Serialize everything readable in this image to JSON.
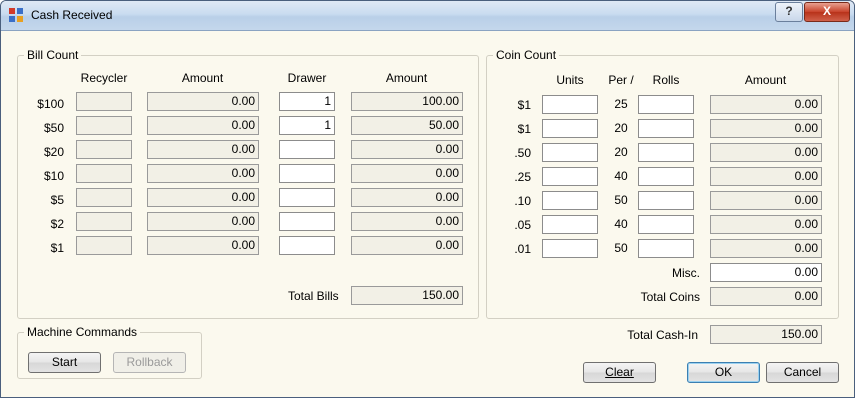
{
  "window": {
    "title": "Cash Received",
    "help_label": "?",
    "close_label": "X"
  },
  "bill_count": {
    "title": "Bill Count",
    "headers": {
      "recycler": "Recycler",
      "amount1": "Amount",
      "drawer": "Drawer",
      "amount2": "Amount"
    },
    "rows": [
      {
        "denom": "$100",
        "recycler": "",
        "amount1": "0.00",
        "drawer": "1",
        "amount2": "100.00"
      },
      {
        "denom": "$50",
        "recycler": "",
        "amount1": "0.00",
        "drawer": "1",
        "amount2": "50.00"
      },
      {
        "denom": "$20",
        "recycler": "",
        "amount1": "0.00",
        "drawer": "",
        "amount2": "0.00"
      },
      {
        "denom": "$10",
        "recycler": "",
        "amount1": "0.00",
        "drawer": "",
        "amount2": "0.00"
      },
      {
        "denom": "$5",
        "recycler": "",
        "amount1": "0.00",
        "drawer": "",
        "amount2": "0.00"
      },
      {
        "denom": "$2",
        "recycler": "",
        "amount1": "0.00",
        "drawer": "",
        "amount2": "0.00"
      },
      {
        "denom": "$1",
        "recycler": "",
        "amount1": "0.00",
        "drawer": "",
        "amount2": "0.00"
      }
    ],
    "total_label": "Total Bills",
    "total_value": "150.00"
  },
  "coin_count": {
    "title": "Coin Count",
    "headers": {
      "units": "Units",
      "per": "Per /",
      "rolls": "Rolls",
      "amount": "Amount"
    },
    "rows": [
      {
        "denom": "$1",
        "units": "",
        "per": "25",
        "rolls": "",
        "amount": "0.00"
      },
      {
        "denom": "$1",
        "units": "",
        "per": "20",
        "rolls": "",
        "amount": "0.00"
      },
      {
        "denom": ".50",
        "units": "",
        "per": "20",
        "rolls": "",
        "amount": "0.00"
      },
      {
        "denom": ".25",
        "units": "",
        "per": "40",
        "rolls": "",
        "amount": "0.00"
      },
      {
        "denom": ".10",
        "units": "",
        "per": "50",
        "rolls": "",
        "amount": "0.00"
      },
      {
        "denom": ".05",
        "units": "",
        "per": "40",
        "rolls": "",
        "amount": "0.00"
      },
      {
        "denom": ".01",
        "units": "",
        "per": "50",
        "rolls": "",
        "amount": "0.00"
      }
    ],
    "misc_label": "Misc.",
    "misc_value": "0.00",
    "total_label": "Total Coins",
    "total_value": "0.00"
  },
  "machine_commands": {
    "title": "Machine Commands",
    "start_label": "Start",
    "rollback_label": "Rollback"
  },
  "total_cash_in": {
    "label": "Total Cash-In",
    "value": "150.00"
  },
  "buttons": {
    "clear_label": "Clear",
    "ok_label": "OK",
    "cancel_label": "Cancel"
  }
}
